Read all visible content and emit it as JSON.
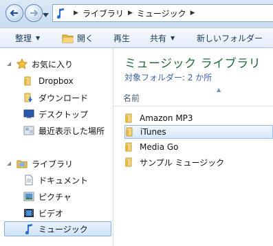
{
  "address": {
    "crumbs": [
      "ライブラリ",
      "ミュージック"
    ],
    "icon": "music-note-icon"
  },
  "toolbar": {
    "organize": "整理",
    "open": "開く",
    "play": "再生",
    "share": "共有",
    "new_folder": "新しいフォルダー"
  },
  "nav": {
    "favorites": {
      "label": "お気に入り",
      "items": [
        {
          "label": "Dropbox",
          "icon": "folder-icon"
        },
        {
          "label": "ダウンロード",
          "icon": "download-folder-icon"
        },
        {
          "label": "デスクトップ",
          "icon": "desktop-icon"
        },
        {
          "label": "最近表示した場所",
          "icon": "recent-places-icon"
        }
      ]
    },
    "libraries": {
      "label": "ライブラリ",
      "items": [
        {
          "label": "ドキュメント",
          "icon": "document-icon"
        },
        {
          "label": "ピクチャ",
          "icon": "picture-icon"
        },
        {
          "label": "ビデオ",
          "icon": "video-icon"
        },
        {
          "label": "ミュージック",
          "icon": "music-icon",
          "selected": true
        }
      ]
    }
  },
  "content": {
    "title": "ミュージック ライブラリ",
    "subtitle": "対象フォルダー: 2 か所",
    "column_name": "名前",
    "rows": [
      {
        "name": "Amazon MP3"
      },
      {
        "name": "iTunes",
        "selected": true
      },
      {
        "name": "Media Go"
      },
      {
        "name": "サンプル ミュージック"
      }
    ]
  }
}
